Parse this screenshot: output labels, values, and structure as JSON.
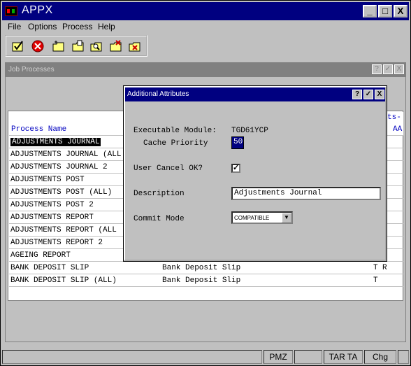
{
  "app": {
    "title": "APPX"
  },
  "titlebar_buttons": {
    "minimize": "_",
    "maximize": "□",
    "close": "X"
  },
  "menu": [
    {
      "label": "File"
    },
    {
      "label": "Options"
    },
    {
      "label": "Process"
    },
    {
      "label": "Help"
    }
  ],
  "toolbar": {
    "icons": [
      "ok-icon",
      "cancel-icon",
      "new-folder-icon",
      "open-folder-icon",
      "find-icon",
      "delete-folder-icon",
      "close-folder-icon"
    ]
  },
  "mdi": {
    "title": "Job Processes",
    "buttons": {
      "help": "?",
      "ok": "✓",
      "close": "X"
    }
  },
  "grid": {
    "header": {
      "process_name": "Process Name",
      "col_ts": "ts-",
      "col_aa": "AA"
    },
    "rows": [
      {
        "name": "ADJUSTMENTS JOURNAL",
        "desc": "",
        "t": "",
        "r": ""
      },
      {
        "name": "ADJUSTMENTS JOURNAL (ALL",
        "desc": "",
        "t": "",
        "r": ""
      },
      {
        "name": "ADJUSTMENTS JOURNAL 2",
        "desc": "",
        "t": "",
        "r": ""
      },
      {
        "name": "ADJUSTMENTS POST",
        "desc": "",
        "t": "",
        "r": ""
      },
      {
        "name": "ADJUSTMENTS POST (ALL)",
        "desc": "",
        "t": "",
        "r": ""
      },
      {
        "name": "ADJUSTMENTS POST 2",
        "desc": "",
        "t": "",
        "r": ""
      },
      {
        "name": "ADJUSTMENTS REPORT",
        "desc": "",
        "t": "",
        "r": ""
      },
      {
        "name": "ADJUSTMENTS REPORT (ALL",
        "desc": "",
        "t": "",
        "r": ""
      },
      {
        "name": "ADJUSTMENTS REPORT 2",
        "desc": "",
        "t": "",
        "r": ""
      },
      {
        "name": "AGEING REPORT",
        "desc": "",
        "t": "",
        "r": ""
      },
      {
        "name": "BANK DEPOSIT SLIP",
        "desc": "Bank Deposit Slip",
        "t": "T",
        "r": "R"
      },
      {
        "name": "BANK DEPOSIT SLIP (ALL)",
        "desc": "Bank Deposit Slip",
        "t": "T",
        "r": ""
      }
    ]
  },
  "dialog": {
    "title": "Additional Attributes",
    "buttons": {
      "help": "?",
      "ok": "✓",
      "close": "X"
    },
    "executable_module_label": "Executable Module:",
    "executable_module_value": "TGD61YCP",
    "cache_priority_label": "Cache Priority",
    "cache_priority_value": "50",
    "user_cancel_label": "User Cancel OK?",
    "user_cancel_checked": "✓",
    "description_label": "Description",
    "description_value": "Adjustments Journal",
    "commit_mode_label": "Commit Mode",
    "commit_mode_value": "COMPATIBLE",
    "commit_mode_arrow": "▼"
  },
  "statusbar": {
    "pmz": "PMZ",
    "tar": "TAR TA",
    "chg": "Chg"
  }
}
